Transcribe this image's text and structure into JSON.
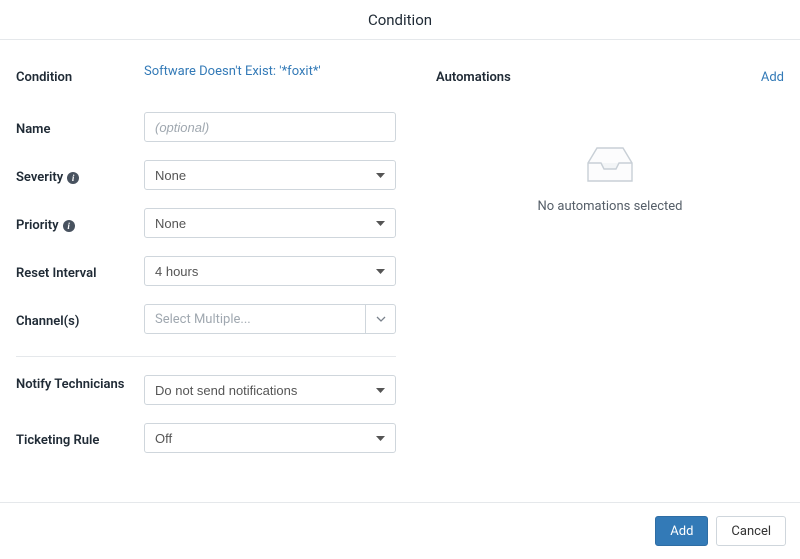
{
  "title": "Condition",
  "form": {
    "conditionLabel": "Condition",
    "conditionValue": "Software Doesn't Exist: '*foxit*'",
    "nameLabel": "Name",
    "namePlaceholder": "(optional)",
    "nameValue": "",
    "severityLabel": "Severity",
    "severityValue": "None",
    "priorityLabel": "Priority",
    "priorityValue": "None",
    "resetLabel": "Reset Interval",
    "resetValue": "4 hours",
    "channelsLabel": "Channel(s)",
    "channelsPlaceholder": "Select Multiple...",
    "notifyLabel": "Notify Technicians",
    "notifyValue": "Do not send notifications",
    "ticketingLabel": "Ticketing Rule",
    "ticketingValue": "Off"
  },
  "automations": {
    "title": "Automations",
    "addLabel": "Add",
    "emptyText": "No automations selected"
  },
  "footer": {
    "add": "Add",
    "cancel": "Cancel"
  }
}
